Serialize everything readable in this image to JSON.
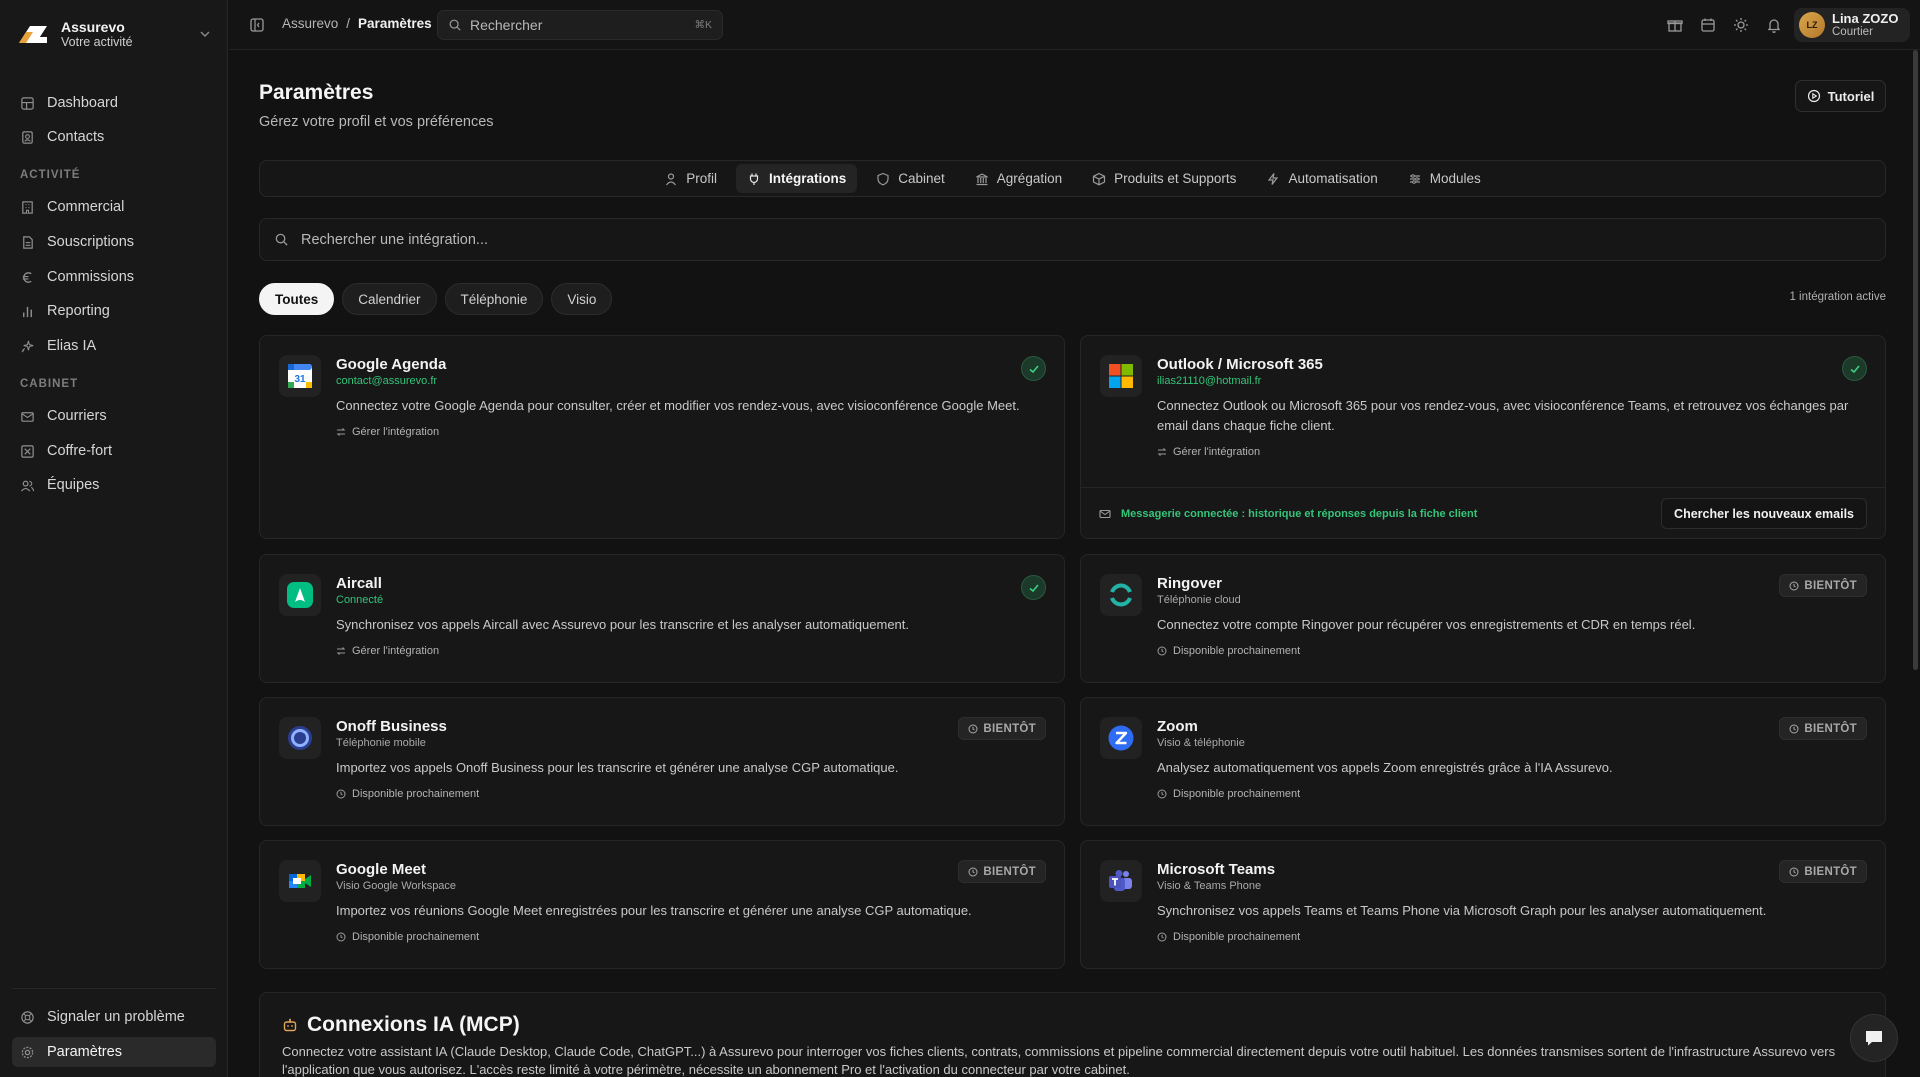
{
  "brand": {
    "name": "Assurevo",
    "subtitle": "Votre activité"
  },
  "sidebar": {
    "top_items": [
      {
        "label": "Dashboard",
        "icon": "dashboard-icon"
      },
      {
        "label": "Contacts",
        "icon": "contacts-icon"
      }
    ],
    "section_activite": "ACTIVITÉ",
    "activite_items": [
      {
        "label": "Commercial",
        "icon": "building-icon"
      },
      {
        "label": "Souscriptions",
        "icon": "file-icon"
      },
      {
        "label": "Commissions",
        "icon": "euro-icon"
      },
      {
        "label": "Reporting",
        "icon": "bar-chart-icon"
      },
      {
        "label": "Elias IA",
        "icon": "sparkles-icon"
      }
    ],
    "section_cabinet": "CABINET",
    "cabinet_items": [
      {
        "label": "Courriers",
        "icon": "mail-icon"
      },
      {
        "label": "Coffre-fort",
        "icon": "vault-icon"
      },
      {
        "label": "Équipes",
        "icon": "users-icon"
      }
    ],
    "bottom_items": [
      {
        "label": "Signaler un problème",
        "icon": "help-icon"
      },
      {
        "label": "Paramètres",
        "icon": "settings-icon",
        "active": true
      }
    ]
  },
  "topbar": {
    "breadcrumb_root": "Assurevo",
    "breadcrumb_sep": "/",
    "breadcrumb_current": "Paramètres",
    "search_placeholder": "Rechercher",
    "search_shortcut": "⌘K",
    "user": {
      "initials": "LZ",
      "name": "Lina ZOZO",
      "role": "Courtier"
    }
  },
  "page": {
    "title": "Paramètres",
    "subtitle": "Gérez votre profil et vos préférences",
    "tutorial_label": "Tutoriel"
  },
  "tabs": [
    {
      "label": "Profil",
      "icon": "user-icon"
    },
    {
      "label": "Intégrations",
      "icon": "plug-icon",
      "active": true
    },
    {
      "label": "Cabinet",
      "icon": "shield-icon"
    },
    {
      "label": "Agrégation",
      "icon": "bank-icon"
    },
    {
      "label": "Produits et Supports",
      "icon": "package-icon"
    },
    {
      "label": "Automatisation",
      "icon": "zap-icon"
    },
    {
      "label": "Modules",
      "icon": "sliders-icon"
    }
  ],
  "integrations_search_placeholder": "Rechercher une intégration...",
  "filters": [
    "Toutes",
    "Calendrier",
    "Téléphonie",
    "Visio"
  ],
  "active_count": "1 intégration active",
  "manage_label": "Gérer l'intégration",
  "soon_label": "BIENTÔT",
  "soon_note": "Disponible prochainement",
  "cards": {
    "google_agenda": {
      "title": "Google Agenda",
      "subtitle": "contact@assurevo.fr",
      "description": "Connectez votre Google Agenda pour consulter, créer et modifier vos rendez-vous, avec visioconférence Google Meet."
    },
    "outlook": {
      "title": "Outlook / Microsoft 365",
      "subtitle": "ilias21110@hotmail.fr",
      "description": "Connectez Outlook ou Microsoft 365 pour vos rendez-vous, avec visioconférence Teams, et retrouvez vos échanges par email dans chaque fiche client.",
      "footer_message": "Messagerie connectée : historique et réponses depuis la fiche client",
      "footer_button": "Chercher les nouveaux emails"
    },
    "aircall": {
      "title": "Aircall",
      "subtitle": "Connecté",
      "description": "Synchronisez vos appels Aircall avec Assurevo pour les transcrire et les analyser automatiquement."
    },
    "ringover": {
      "title": "Ringover",
      "subtitle": "Téléphonie cloud",
      "description": "Connectez votre compte Ringover pour récupérer vos enregistrements et CDR en temps réel."
    },
    "onoff": {
      "title": "Onoff Business",
      "subtitle": "Téléphonie mobile",
      "description": "Importez vos appels Onoff Business pour les transcrire et générer une analyse CGP automatique."
    },
    "zoom": {
      "title": "Zoom",
      "subtitle": "Visio & téléphonie",
      "description": "Analysez automatiquement vos appels Zoom enregistrés grâce à l'IA Assurevo."
    },
    "meet": {
      "title": "Google Meet",
      "subtitle": "Visio Google Workspace",
      "description": "Importez vos réunions Google Meet enregistrées pour les transcrire et générer une analyse CGP automatique."
    },
    "teams": {
      "title": "Microsoft Teams",
      "subtitle": "Visio & Teams Phone",
      "description": "Synchronisez vos appels Teams et Teams Phone via Microsoft Graph pour les analyser automatiquement."
    }
  },
  "mcp": {
    "title": "Connexions IA (MCP)",
    "description": "Connectez votre assistant IA (Claude Desktop, Claude Code, ChatGPT...) à Assurevo pour interroger vos fiches clients, contrats, commissions et pipeline commercial directement depuis votre outil habituel. Les données transmises sortent de l'infrastructure Assurevo vers l'application que vous autorisez. L'accès reste limité à votre périmètre, nécessite un abonnement Pro et l'activation du connecteur par votre cabinet."
  },
  "colors": {
    "accent_green": "#34c47a",
    "background": "#121212",
    "card": "#171717"
  }
}
